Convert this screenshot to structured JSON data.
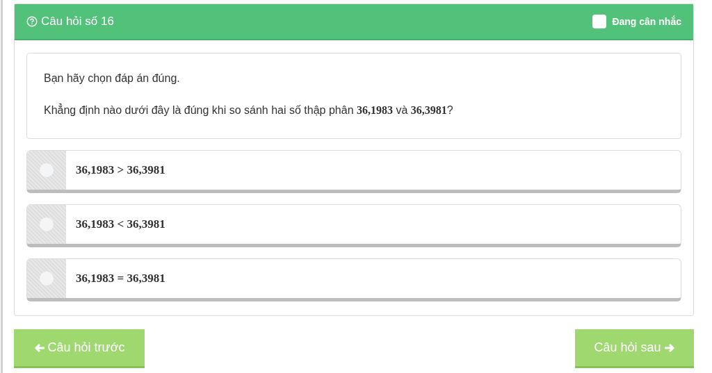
{
  "header": {
    "title": "Câu hỏi số 16",
    "flag": {
      "label": "Đang cân nhắc",
      "checked": false
    }
  },
  "question": {
    "instruction": "Bạn hãy chọn đáp án đúng.",
    "text": "Khẳng định nào dưới đây là đúng khi so sánh hai số thập phân **36,1983** và **36,3981**?"
  },
  "options": [
    {
      "label": "36,1983 > 36,3981",
      "selected": false
    },
    {
      "label": "36,1983 < 36,3981",
      "selected": false
    },
    {
      "label": "36,1983 = 36,3981",
      "selected": false
    }
  ],
  "nav": {
    "previous": "Câu hỏi trước",
    "next": "Câu hỏi sau"
  }
}
